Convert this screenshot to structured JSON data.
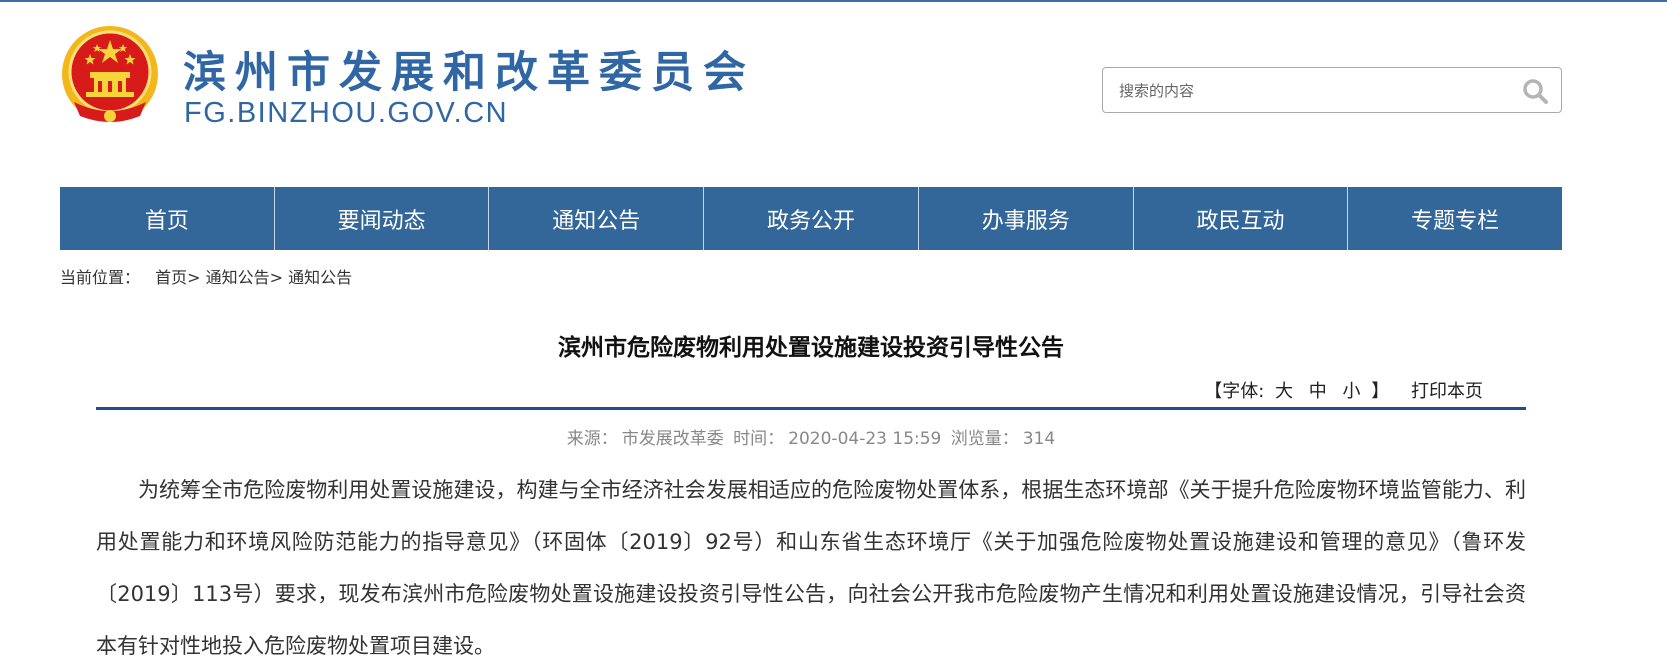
{
  "colors": {
    "brand_blue": "#2f66a3",
    "nav_bg": "#336699",
    "rule": "#1e4f86",
    "emblem_red": "#d71a1a",
    "emblem_gold": "#f4c21b"
  },
  "header": {
    "site_title": "滨州市发展和改革委员会",
    "site_domain": "FG.BINZHOU.GOV.CN",
    "emblem_icon": "national-emblem-icon"
  },
  "search": {
    "placeholder": "搜索的内容",
    "icon": "search-icon"
  },
  "nav": {
    "items": [
      "首页",
      "要闻动态",
      "通知公告",
      "政务公开",
      "办事服务",
      "政民互动",
      "专题专栏"
    ]
  },
  "breadcrumb": {
    "label": "当前位置：",
    "items": [
      "首页",
      "通知公告",
      "通知公告"
    ],
    "separator": ">"
  },
  "article": {
    "title": "滨州市危险废物利用处置设施建设投资引导性公告",
    "font_tools": {
      "open": "【字体:",
      "large": "大",
      "medium": "中",
      "small": "小",
      "close": "】"
    },
    "print_label": "打印本页",
    "meta": {
      "source_label": "来源：",
      "source": "市发展改革委",
      "time_label": "时间：",
      "time": "2020-04-23 15:59",
      "views_label": "浏览量：",
      "views": "314"
    },
    "paragraph": "为统筹全市危险废物利用处置设施建设，构建与全市经济社会发展相适应的危险废物处置体系，根据生态环境部《关于提升危险废物环境监管能力、利用处置能力和环境风险防范能力的指导意见》（环固体〔2019〕92号）和山东省生态环境厅《关于加强危险废物处置设施建设和管理的意见》（鲁环发〔2019〕113号）要求，现发布滨州市危险废物处置设施建设投资引导性公告，向社会公开我市危险废物产生情况和利用处置设施建设情况，引导社会资本有针对性地投入危险废物处置项目建设。"
  }
}
